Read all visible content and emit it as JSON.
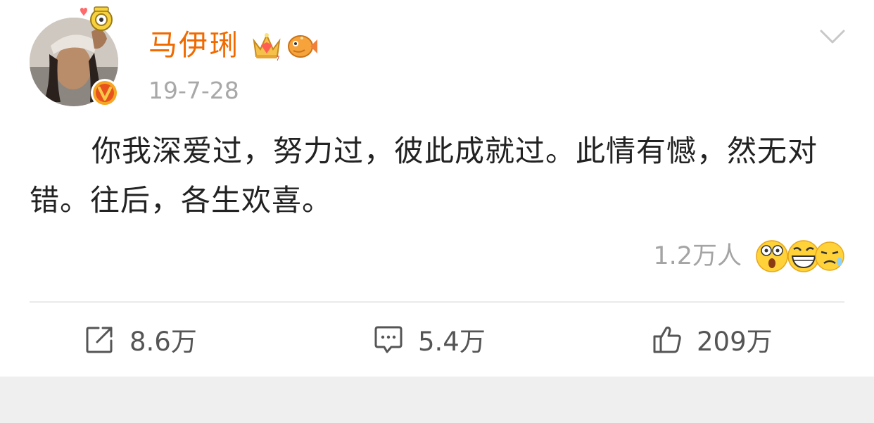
{
  "post": {
    "author": "马伊琍",
    "timestamp": "19-7-28",
    "text": "你我深爱过，努力过，彼此成就过。此情有憾，然无对错。往后，各生欢喜。"
  },
  "reactions": {
    "count_label": "1.2万人",
    "emojis": [
      "shocked-emoji",
      "laughing-emoji",
      "sigh-emoji"
    ]
  },
  "actions": {
    "repost_count": "8.6万",
    "comment_count": "5.4万",
    "like_count": "209万"
  },
  "colors": {
    "username": "#f06a00",
    "timestamp": "#a8a8a8",
    "verified_badge": "#f5a623",
    "background": "#efefef"
  }
}
